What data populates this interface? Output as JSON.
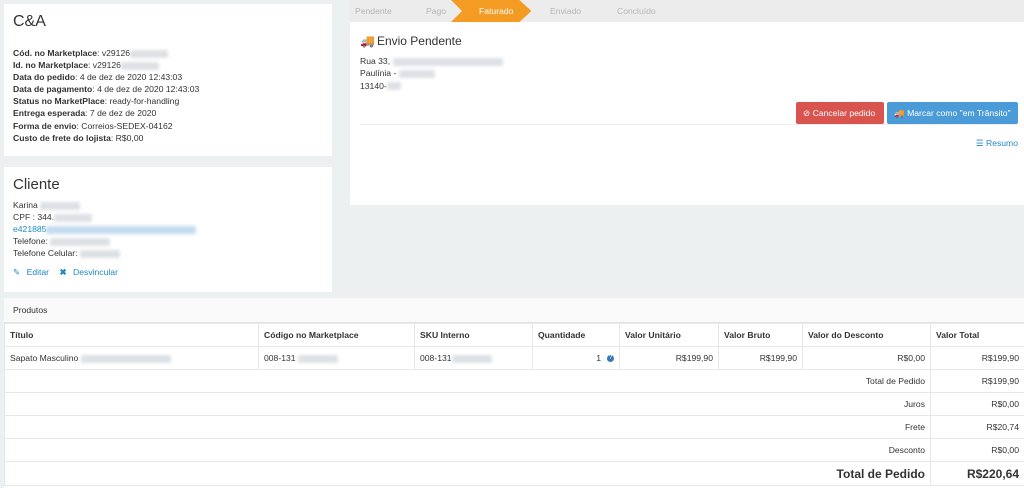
{
  "order": {
    "store": "C&A",
    "fields": [
      {
        "label": "Cód. no Marketplace",
        "value": "v29126"
      },
      {
        "label": "Id. no Marketplace",
        "value": "v29126"
      },
      {
        "label": "Data do pedido",
        "value": "4 de dez de 2020 12:43:03"
      },
      {
        "label": "Data de pagamento",
        "value": "4 de dez de 2020 12:43:03"
      },
      {
        "label": "Status no MarketPlace",
        "value": "ready-for-handling"
      },
      {
        "label": "Entrega esperada",
        "value": "7 de dez de 2020"
      },
      {
        "label": "Forma de envio",
        "value": "Correios-SEDEX-04162"
      },
      {
        "label": "Custo de frete do lojista",
        "value": "R$0,00"
      }
    ]
  },
  "client": {
    "title": "Cliente",
    "name": "Karina",
    "cpf": "CPF : 344.",
    "email": "e421885",
    "phone": "Telefone:",
    "mobile": "Telefone Celular:",
    "edit": "Editar",
    "unlink": "Desvincular"
  },
  "steps": [
    "Pendente",
    "Pago",
    "Faturado",
    "Enviado",
    "Concluído"
  ],
  "shipping": {
    "title": "Envio Pendente",
    "address_line1": "Rua 33,",
    "address_line2": "Paulínia -",
    "address_line3": "13140-",
    "cancel": "Cancelar pedido",
    "transit": "Marcar como \"em Trânsito\"",
    "resumo": "Resumo"
  },
  "products": {
    "section": "Produtos",
    "headers": [
      "Título",
      "Código no Marketplace",
      "SKU Interno",
      "Quantidade",
      "Valor Unitário",
      "Valor Bruto",
      "Valor do Desconto",
      "Valor Total"
    ],
    "row": {
      "title": "Sapato Masculino",
      "code": "008-131",
      "sku": "008-131",
      "qty": "1",
      "unit": "R$199,90",
      "gross": "R$199,90",
      "discount": "R$0,00",
      "total": "R$199,90"
    },
    "summary": [
      {
        "label": "Total de Pedido",
        "value": "R$199,90"
      },
      {
        "label": "Juros",
        "value": "R$0,00"
      },
      {
        "label": "Frete",
        "value": "R$20,74"
      },
      {
        "label": "Desconto",
        "value": "R$0,00"
      }
    ],
    "grand_total_label": "Total de Pedido",
    "grand_total_value": "R$220,64"
  },
  "colors": {
    "accent": "#f49b24",
    "danger": "#d9534f",
    "primary": "#4a9bd7",
    "link": "#1e88c7"
  }
}
